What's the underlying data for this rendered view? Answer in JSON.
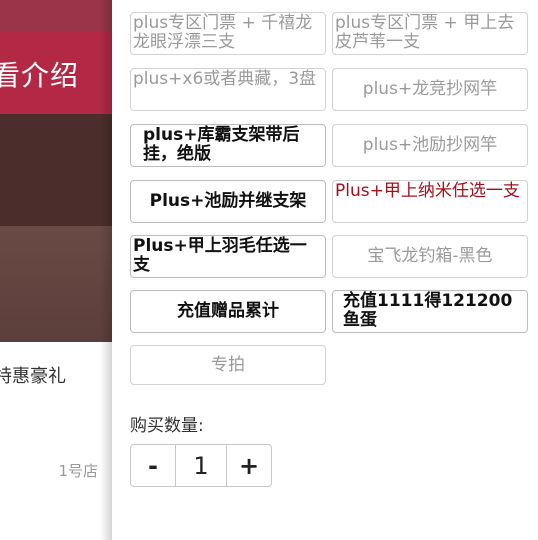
{
  "background": {
    "banner_text": "看介绍",
    "promo_text": "特惠豪礼",
    "store_label": "1号店"
  },
  "options": [
    {
      "label": "plus专区门票 + 千禧龙龙眼浮漂三支"
    },
    {
      "label": "plus专区门票 + 甲上去皮芦苇一支"
    },
    {
      "label": "plus+x6或者典藏，3盘"
    },
    {
      "label": "plus+龙竞抄网竿"
    },
    {
      "label": "plus+库霸支架带后挂，绝版"
    },
    {
      "label": "plus+池励抄网竿"
    },
    {
      "label": "Plus+池励并继支架"
    },
    {
      "label": "Plus+甲上纳米任选一支"
    },
    {
      "label": "Plus+甲上羽毛任选一支"
    },
    {
      "label": "宝飞龙钓箱-黑色"
    },
    {
      "label": "充值赠品累计"
    },
    {
      "label": "充值1111得121200鱼蛋"
    },
    {
      "label": "专拍"
    }
  ],
  "quantity": {
    "label": "购买数量:",
    "minus": "-",
    "value": "1",
    "plus": "+"
  },
  "colors": {
    "selected_text": "#a3101c",
    "banner": "#b22845"
  }
}
